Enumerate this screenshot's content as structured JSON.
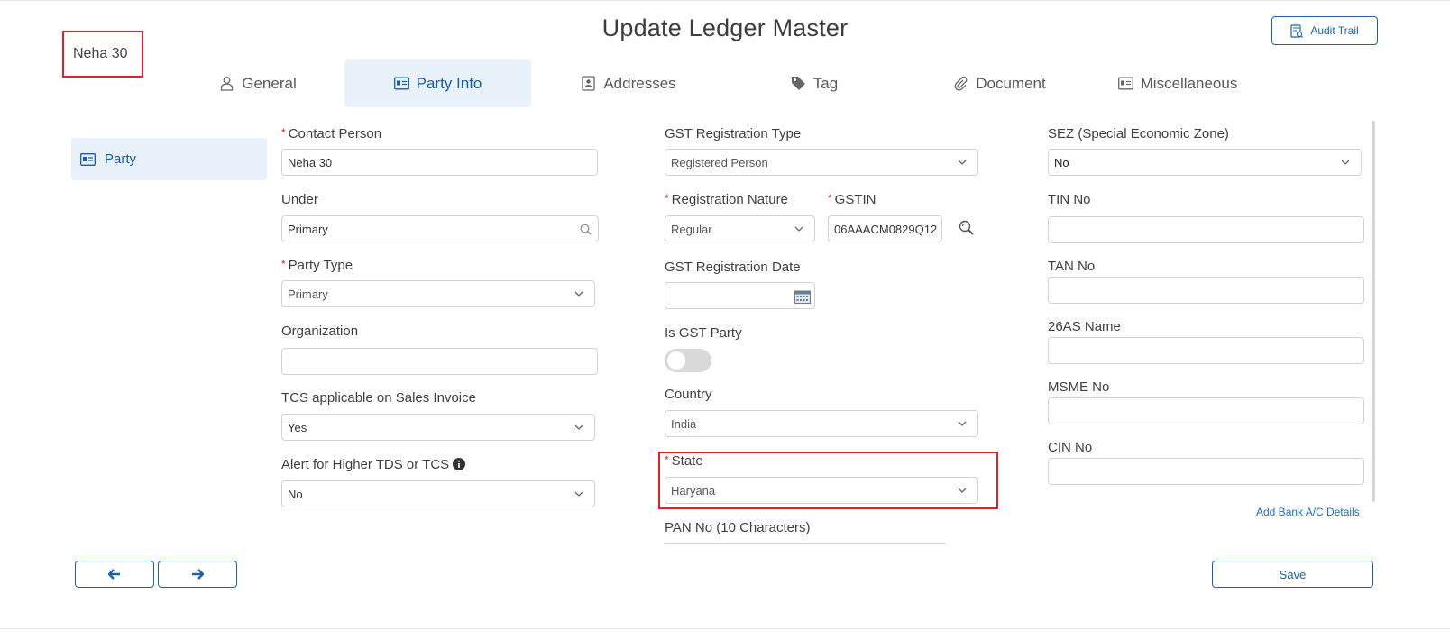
{
  "page": {
    "title": "Update Ledger Master",
    "ledger_name": "Neha 30",
    "audit_trail_label": "Audit Trail"
  },
  "tabs": [
    {
      "label": "General",
      "icon": "user-icon",
      "active": false
    },
    {
      "label": "Party Info",
      "icon": "id-card-icon",
      "active": true
    },
    {
      "label": "Addresses",
      "icon": "address-book-icon",
      "active": false
    },
    {
      "label": "Tag",
      "icon": "tag-icon",
      "active": false
    },
    {
      "label": "Document",
      "icon": "paperclip-icon",
      "active": false
    },
    {
      "label": "Miscellaneous",
      "icon": "id-card-icon",
      "active": false
    }
  ],
  "sidebar": {
    "items": [
      {
        "label": "Party",
        "icon": "id-card-icon",
        "active": true
      }
    ]
  },
  "form": {
    "contact_person": {
      "label": "Contact Person",
      "required": true,
      "value": "Neha 30"
    },
    "under": {
      "label": "Under",
      "value": "Primary"
    },
    "party_type": {
      "label": "Party Type",
      "required": true,
      "value": "Primary"
    },
    "organization": {
      "label": "Organization",
      "value": ""
    },
    "tcs_applicable": {
      "label": "TCS applicable on Sales Invoice",
      "value": "Yes"
    },
    "alert_higher_tds": {
      "label": "Alert for Higher TDS or TCS",
      "value": "No"
    },
    "gst_registration_type": {
      "label": "GST Registration Type",
      "value": "Registered Person"
    },
    "registration_nature": {
      "label": "Registration Nature",
      "required": true,
      "value": "Regular"
    },
    "gstin": {
      "label": "GSTIN",
      "required": true,
      "value": "06AAACM0829Q12"
    },
    "gst_registration_date": {
      "label": "GST Registration Date",
      "value": ""
    },
    "is_gst_party": {
      "label": "Is GST Party",
      "on": false
    },
    "country": {
      "label": "Country",
      "value": "India"
    },
    "state": {
      "label": "State",
      "required": true,
      "value": "Haryana"
    },
    "pan_no": {
      "label": "PAN No (10 Characters)",
      "value": ""
    },
    "sez": {
      "label": "SEZ (Special Economic Zone)",
      "value": "No"
    },
    "tin_no": {
      "label": "TIN No",
      "value": ""
    },
    "tan_no": {
      "label": "TAN No",
      "value": ""
    },
    "name_26as": {
      "label": "26AS Name",
      "value": ""
    },
    "msme_no": {
      "label": "MSME No",
      "value": ""
    },
    "cin_no": {
      "label": "CIN No",
      "value": ""
    }
  },
  "actions": {
    "add_bank_label": "Add Bank A/C Details",
    "save_label": "Save",
    "prev_icon": "arrow-left-icon",
    "next_icon": "arrow-right-icon"
  },
  "colors": {
    "accent": "#1c62a8",
    "active_tab_bg": "#e9f1fb",
    "required": "#e0202a",
    "highlight_border": "#e0202a"
  }
}
